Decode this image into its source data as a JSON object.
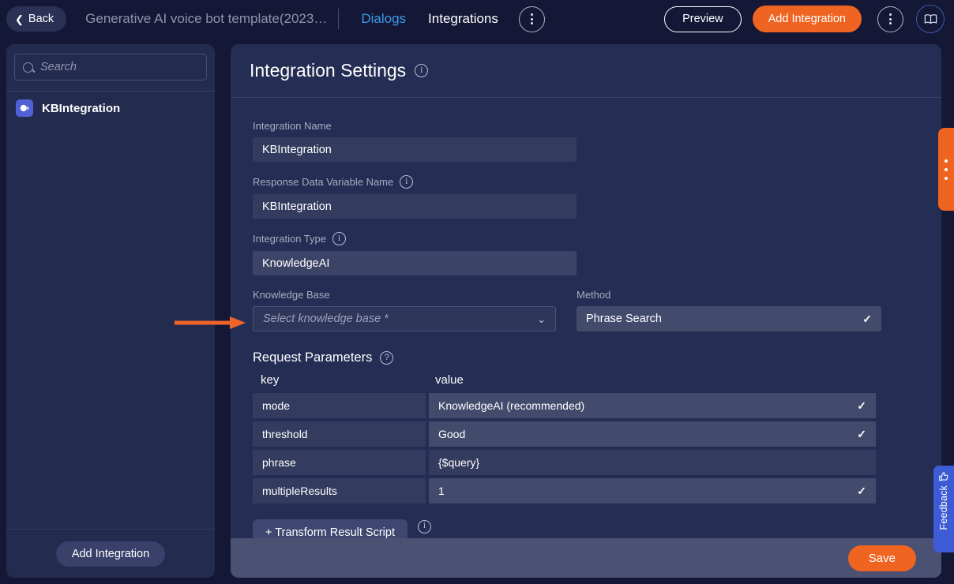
{
  "topbar": {
    "back_label": "Back",
    "bot_title": "Generative AI voice bot template(2023…",
    "nav": [
      {
        "label": "Dialogs",
        "active": true
      },
      {
        "label": "Integrations",
        "active": false
      }
    ],
    "preview_label": "Preview",
    "add_integration_label": "Add Integration",
    "icons": {
      "back_chevron": "chevron-left-icon",
      "overflow_menu": "kebab-menu-icon",
      "book": "open-book-icon"
    }
  },
  "sidebar": {
    "search_placeholder": "Search",
    "search_value": "",
    "items": [
      {
        "label": "KBIntegration",
        "icon": "knowledge-base-icon"
      }
    ],
    "add_integration_label": "Add Integration"
  },
  "panel": {
    "title": "Integration Settings",
    "fields": {
      "integration_name_label": "Integration Name",
      "integration_name_value": "KBIntegration",
      "response_var_label": "Response Data Variable Name",
      "response_var_value": "KBIntegration",
      "integration_type_label": "Integration Type",
      "integration_type_value": "KnowledgeAI",
      "knowledge_base_label": "Knowledge Base",
      "knowledge_base_placeholder": "Select knowledge base *",
      "method_label": "Method",
      "method_value": "Phrase Search"
    },
    "request_parameters": {
      "title": "Request Parameters",
      "columns": [
        "key",
        "value"
      ],
      "rows": [
        {
          "key": "mode",
          "value": "KnowledgeAI (recommended)",
          "dropdown": true
        },
        {
          "key": "threshold",
          "value": "Good",
          "dropdown": true
        },
        {
          "key": "phrase",
          "value": "{$query}",
          "dropdown": false
        },
        {
          "key": "multipleResults",
          "value": "1",
          "dropdown": true
        }
      ]
    },
    "transform_button_label": "+ Transform Result Script",
    "save_label": "Save"
  },
  "edge_tabs": {
    "feedback_label": "Feedback",
    "feedback_icon": "thumbs-up-icon",
    "quick_menu_icon": "vertical-dots-icon"
  },
  "annotation": {
    "arrow_color": "#f0642a",
    "points_to": "knowledge-base-select"
  },
  "colors": {
    "accent_orange": "#f06422",
    "accent_blue": "#3e9ae8",
    "panel_bg": "#242d53",
    "sidebar_bg": "#232b4f",
    "page_bg": "#141836",
    "feedback_blue": "#3d5bd4"
  }
}
